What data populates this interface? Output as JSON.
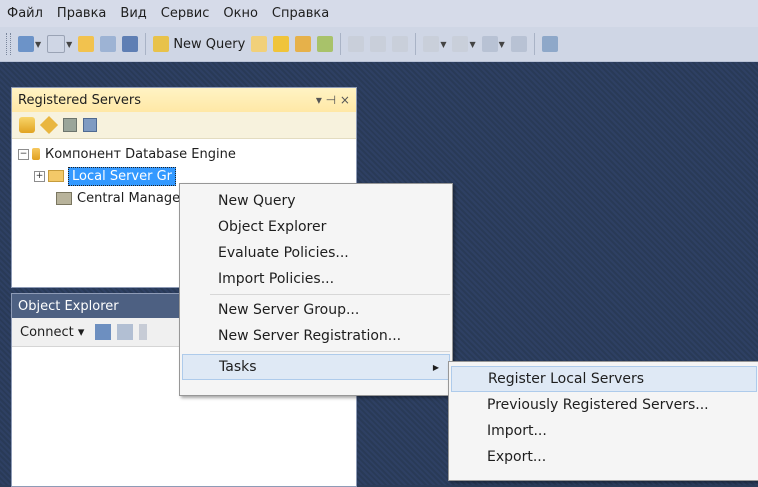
{
  "menubar": [
    "Файл",
    "Правка",
    "Вид",
    "Сервис",
    "Окно",
    "Справка"
  ],
  "toolbar": {
    "new_query_label": "New Query"
  },
  "registered_servers": {
    "title": "Registered Servers",
    "pin": "▾ ⊣ ×",
    "tree": {
      "root": "Компонент Database Engine",
      "local_group": "Local Server Gr",
      "central": "Central Manage"
    }
  },
  "object_explorer": {
    "title": "Object Explorer",
    "connect_label": "Connect ▾"
  },
  "context_menu": {
    "items": [
      "New Query",
      "Object Explorer",
      "Evaluate Policies...",
      "Import Policies...",
      "New Server Group...",
      "New Server Registration...",
      "Tasks"
    ]
  },
  "submenu": {
    "items": [
      "Register Local Servers",
      "Previously Registered Servers...",
      "Import...",
      "Export..."
    ]
  },
  "colors": {
    "workspace": "#2b3c59",
    "selection": "#3399ff",
    "menu_highlight": "#dfe9f5"
  }
}
